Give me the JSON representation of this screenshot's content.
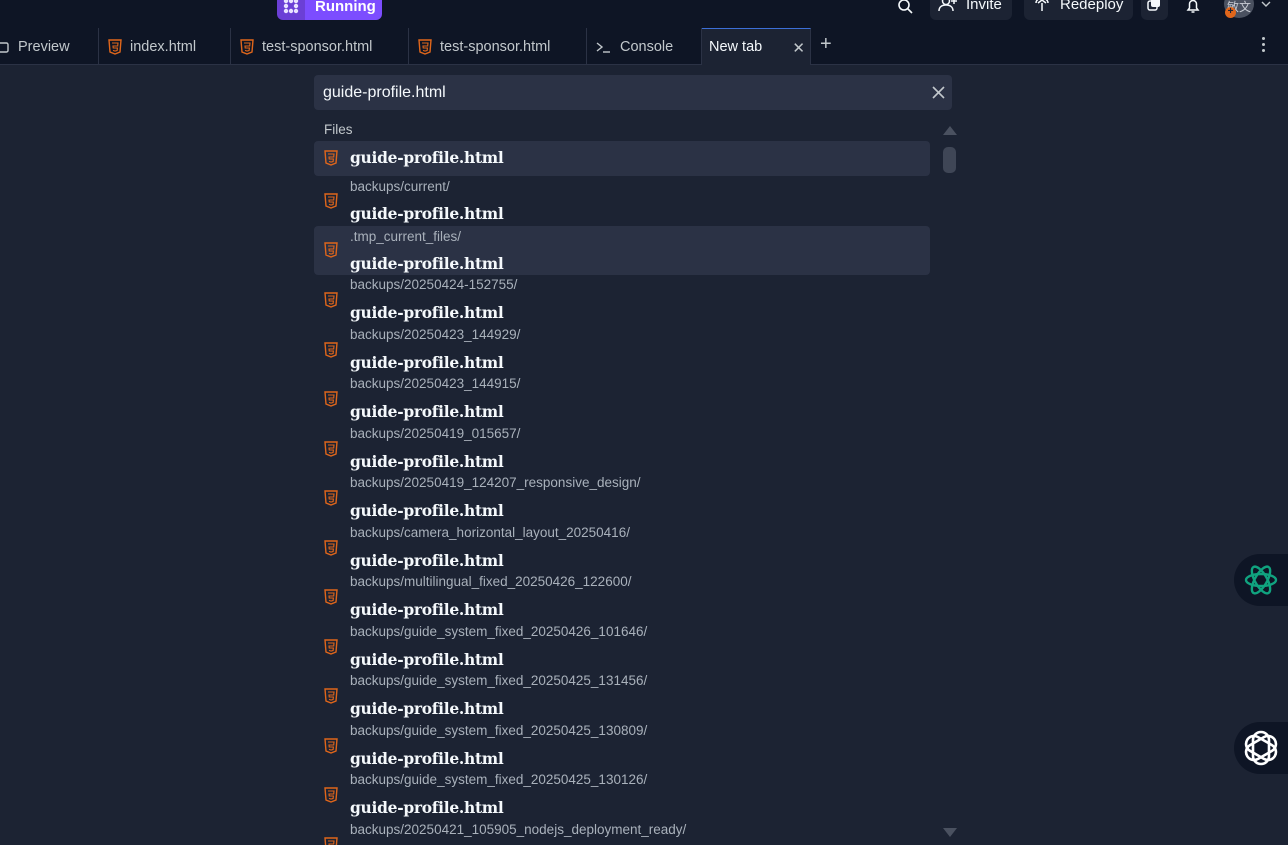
{
  "topbar": {
    "run_label": "Running",
    "invite_label": "Invite",
    "redeploy_label": "Redeploy",
    "avatar_text": "敏文",
    "avatar_badge": "+"
  },
  "tabs": [
    {
      "label": "Preview",
      "icon": "preview-icon"
    },
    {
      "label": "index.html",
      "icon": "html5-icon"
    },
    {
      "label": "test-sponsor.html",
      "icon": "html5-icon"
    },
    {
      "label": "test-sponsor.html",
      "icon": "html5-icon"
    },
    {
      "label": "Console",
      "icon": "terminal-icon"
    },
    {
      "label": "New tab",
      "active": true
    }
  ],
  "search": {
    "value": "guide-profile.html",
    "placeholder": ""
  },
  "files_section_label": "Files",
  "results": [
    {
      "path": "",
      "name": "guide-profile.html"
    },
    {
      "path": "backups/current/",
      "name": "guide-profile.html"
    },
    {
      "path": ".tmp_current_files/",
      "name": "guide-profile.html"
    },
    {
      "path": "backups/20250424-152755/",
      "name": "guide-profile.html"
    },
    {
      "path": "backups/20250423_144929/",
      "name": "guide-profile.html"
    },
    {
      "path": "backups/20250423_144915/",
      "name": "guide-profile.html"
    },
    {
      "path": "backups/20250419_015657/",
      "name": "guide-profile.html"
    },
    {
      "path": "backups/20250419_124207_responsive_design/",
      "name": "guide-profile.html"
    },
    {
      "path": "backups/camera_horizontal_layout_20250416/",
      "name": "guide-profile.html"
    },
    {
      "path": "backups/multilingual_fixed_20250426_122600/",
      "name": "guide-profile.html"
    },
    {
      "path": "backups/guide_system_fixed_20250426_101646/",
      "name": "guide-profile.html"
    },
    {
      "path": "backups/guide_system_fixed_20250425_131456/",
      "name": "guide-profile.html"
    },
    {
      "path": "backups/guide_system_fixed_20250425_130809/",
      "name": "guide-profile.html"
    },
    {
      "path": "backups/guide_system_fixed_20250425_130126/",
      "name": "guide-profile.html"
    },
    {
      "path": "backups/20250421_105905_nodejs_deployment_ready/",
      "name": ""
    }
  ],
  "colors": {
    "accent": "#7c4dff",
    "html_icon": "#e0661b",
    "assistant": "#10a37f"
  }
}
